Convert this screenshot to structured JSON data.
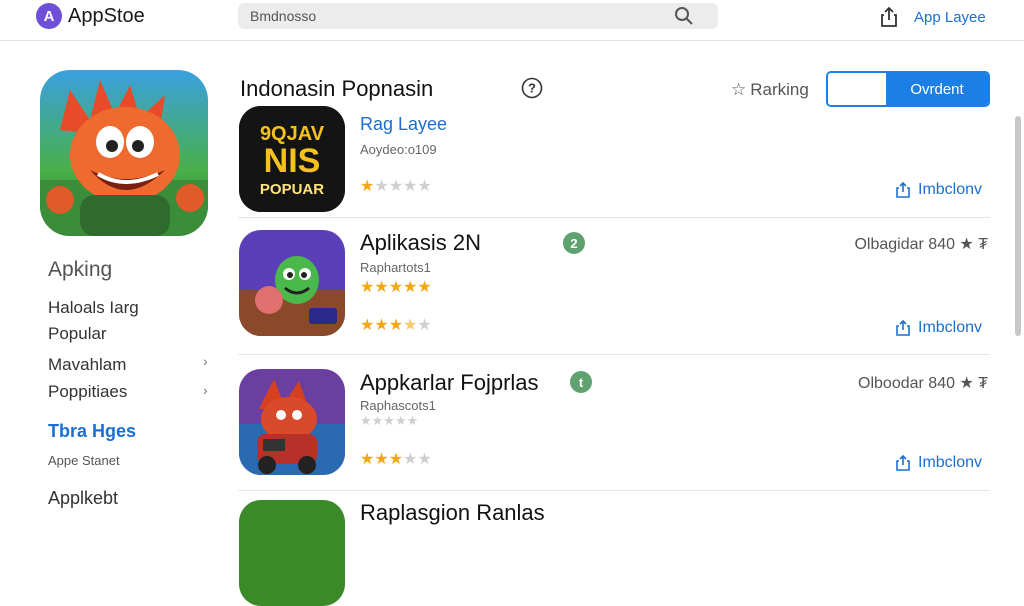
{
  "header": {
    "brand_name": "AppStoe",
    "brand_logo_letter": "A",
    "search_value": "Bmdnosso",
    "top_link": "App Layee"
  },
  "sidebar": {
    "title": "Apking",
    "items": [
      {
        "label": "Haloals Iarg"
      },
      {
        "label": "Popular"
      },
      {
        "label": "Mavahlam"
      },
      {
        "label": "Poppitiaes"
      }
    ],
    "link": "Tbra Hges",
    "small": "Appe Stanet",
    "bottom": "Applkebt"
  },
  "main": {
    "section_title": "Indonasin  Popnasin",
    "ranking_label": "Rarking",
    "segment_label": "Ovrdent",
    "apps": [
      {
        "name": "Rag Layee",
        "developer": "Aoydeo:o109",
        "rating": 1,
        "icon_lines": [
          "9QJAV",
          "NIS",
          "POPUAR"
        ],
        "install": "Imbclonv",
        "meta": "",
        "badge": ""
      },
      {
        "name": "Aplikasis 2N",
        "developer": "Raphartots1",
        "rating": 5,
        "rating2": 3.5,
        "install": "Imbclonv",
        "meta": "Olbagidar 840 ★ ₮",
        "badge": "2"
      },
      {
        "name": "Appkarlar Fojprlas",
        "developer": "Raphascots1",
        "rating": 3,
        "install": "Imbclonv",
        "meta": "Olboodar 840 ★ ₮",
        "badge": "t"
      },
      {
        "name": "Raplasgion Ranlas",
        "developer": "",
        "rating": 0,
        "install": "",
        "meta": "",
        "badge": ""
      }
    ]
  },
  "colors": {
    "accent": "#1b7fe6",
    "star": "#f3a712",
    "badge": "#5fa16f"
  }
}
